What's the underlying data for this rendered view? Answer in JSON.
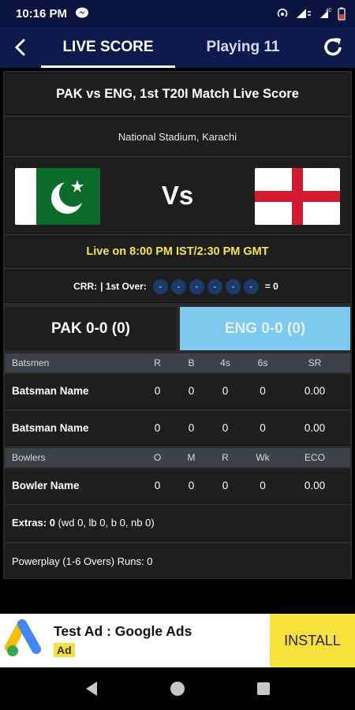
{
  "status_bar": {
    "time": "10:16 PM"
  },
  "header": {
    "tabs": [
      {
        "label": "LIVE SCORE"
      },
      {
        "label": "Playing 11"
      }
    ]
  },
  "match": {
    "title": "PAK vs ENG, 1st T20I Match Live Score",
    "venue": "National Stadium, Karachi",
    "vs_label": "Vs",
    "live_time": "Live on 8:00 PM IST/2:30 PM GMT",
    "crr_label": "CRR:",
    "over_label": "| 1st Over:",
    "over_balls": [
      "-",
      "-",
      "-",
      "-",
      "-",
      "-"
    ],
    "over_total": "= 0"
  },
  "teams": {
    "pak": {
      "score": "PAK 0-0 (0)"
    },
    "eng": {
      "score": "ENG 0-0 (0)"
    }
  },
  "batting_table": {
    "headers": [
      "Batsmen",
      "R",
      "B",
      "4s",
      "6s",
      "SR"
    ],
    "rows": [
      [
        "Batsman Name",
        "0",
        "0",
        "0",
        "0",
        "0.00"
      ],
      [
        "Batsman Name",
        "0",
        "0",
        "0",
        "0",
        "0.00"
      ]
    ]
  },
  "bowling_table": {
    "headers": [
      "Bowlers",
      "O",
      "M",
      "R",
      "Wk",
      "ECO"
    ],
    "rows": [
      [
        "Bowler Name",
        "0",
        "0",
        "0",
        "0",
        "0.00"
      ]
    ]
  },
  "extras": {
    "label": "Extras: 0",
    "detail": " (wd 0, lb 0, b 0, nb 0)"
  },
  "powerplay": {
    "text": "Powerplay (1-6 Overs) Runs: 0"
  },
  "ad": {
    "title": "Test Ad : Google Ads",
    "badge": "Ad",
    "button": "INSTALL"
  },
  "colors": {
    "app_bar": "#0c1a4d",
    "highlight_team": "#7ec9ee",
    "live_text": "#f2e64a",
    "ad_button": "#f6e23a"
  }
}
